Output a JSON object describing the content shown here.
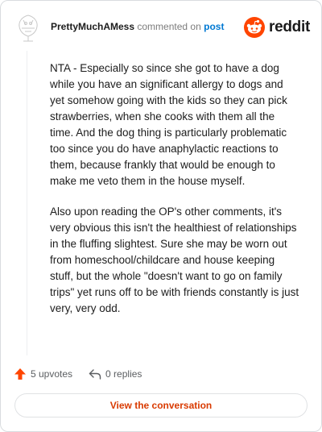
{
  "header": {
    "username": "PrettyMuchAMess",
    "action_text": "commented on",
    "post_link": "post",
    "brand": "reddit",
    "colors": {
      "brand_orange": "#ff4500",
      "link_blue": "#0079d3",
      "button_text": "#d93a00"
    }
  },
  "comment": {
    "paragraphs": [
      "NTA - Especially so since she got to have a dog while you have an significant allergy to dogs and yet somehow going with the kids so they can pick strawberries, when she cooks with them all the time. And the dog thing is particularly problematic too since you do have anaphylactic reactions to them, because frankly that would be enough to make me veto them in the house myself.",
      "Also upon reading the OP's other comments, it's very obvious this isn't the healthiest of relationships in the fluffing slightest. Sure she may be worn out from homeschool/childcare and house keeping stuff, but the whole \"doesn't want to go on family trips\" yet runs off to be with friends constantly is just very, very odd."
    ]
  },
  "actions": {
    "upvotes": "5 upvotes",
    "replies": "0 replies",
    "upvote_icon": "upvote-arrow-icon",
    "reply_icon": "reply-arrow-icon"
  },
  "footer": {
    "view_button": "View the conversation"
  }
}
